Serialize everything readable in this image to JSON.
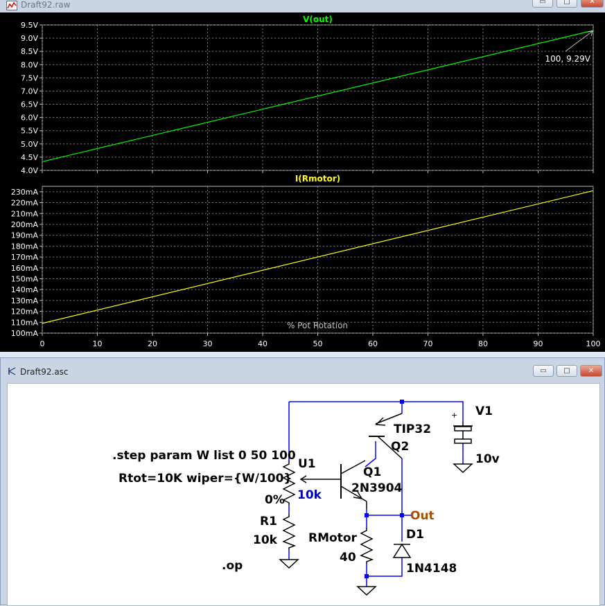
{
  "plot_window": {
    "title": "Draft92.raw",
    "controls": {
      "minimize": "▭",
      "restore": "□",
      "close": "✕"
    }
  },
  "schematic_window": {
    "title": "Draft92.asc",
    "controls": {
      "minimize": "▭",
      "restore": "□",
      "close": "✕"
    }
  },
  "colors": {
    "vout_trace": "#00ff00",
    "irmotor_trace": "#ffff00",
    "plot_bg": "#000000",
    "grid": "#808080",
    "wire": "#0000ff",
    "component": "#000000",
    "net_label": "#a05000",
    "value_label": "#0000c0"
  },
  "chart_data": [
    {
      "type": "line",
      "title": "V(out)",
      "x": [
        0,
        100
      ],
      "series": [
        {
          "name": "V(out)",
          "values": [
            4.33,
            9.29
          ]
        }
      ],
      "xlim": [
        0,
        100
      ],
      "ylim": [
        4.0,
        9.5
      ],
      "yticks": [
        "9.5V",
        "9.0V",
        "8.5V",
        "8.0V",
        "7.5V",
        "7.0V",
        "6.5V",
        "6.0V",
        "5.5V",
        "5.0V",
        "4.5V",
        "4.0V"
      ],
      "ytick_values": [
        9.5,
        9.0,
        8.5,
        8.0,
        7.5,
        7.0,
        6.5,
        6.0,
        5.5,
        5.0,
        4.5,
        4.0
      ],
      "grid": true,
      "cursor_annotation": "100,  9.29V"
    },
    {
      "type": "line",
      "title": "I(Rmotor)",
      "x": [
        0,
        100
      ],
      "series": [
        {
          "name": "I(Rmotor)",
          "values": [
            109,
            231
          ]
        }
      ],
      "xlim": [
        0,
        100
      ],
      "ylim": [
        100,
        235
      ],
      "yticks": [
        "230mA",
        "220mA",
        "210mA",
        "200mA",
        "190mA",
        "180mA",
        "170mA",
        "160mA",
        "150mA",
        "140mA",
        "130mA",
        "120mA",
        "110mA",
        "100mA"
      ],
      "ytick_values": [
        230,
        220,
        210,
        200,
        190,
        180,
        170,
        160,
        150,
        140,
        130,
        120,
        110,
        100
      ],
      "xticks": [
        "0",
        "10",
        "20",
        "30",
        "40",
        "50",
        "60",
        "70",
        "80",
        "90",
        "100"
      ],
      "xtick_values": [
        0,
        10,
        20,
        30,
        40,
        50,
        60,
        70,
        80,
        90,
        100
      ],
      "xlabel": "% Pot Rotation",
      "grid": true
    }
  ],
  "schematic": {
    "directive_step": ".step param W list 0 50 100",
    "pot_params": "Rtot=10K wiper={W/100}",
    "op_directive": ".op",
    "u1_name": "U1",
    "u1_value": "10k",
    "u1_pct": "0%",
    "r1_name": "R1",
    "r1_value": "10k",
    "q1_name": "Q1",
    "q1_model": "2N3904",
    "q2_name": "Q2",
    "q2_model": "TIP32",
    "v1_name": "V1",
    "v1_value": "10v",
    "v1_plus": "+",
    "rmotor_name": "RMotor",
    "rmotor_value": "40",
    "d1_name": "D1",
    "d1_model": "1N4148",
    "out_label": "Out"
  }
}
